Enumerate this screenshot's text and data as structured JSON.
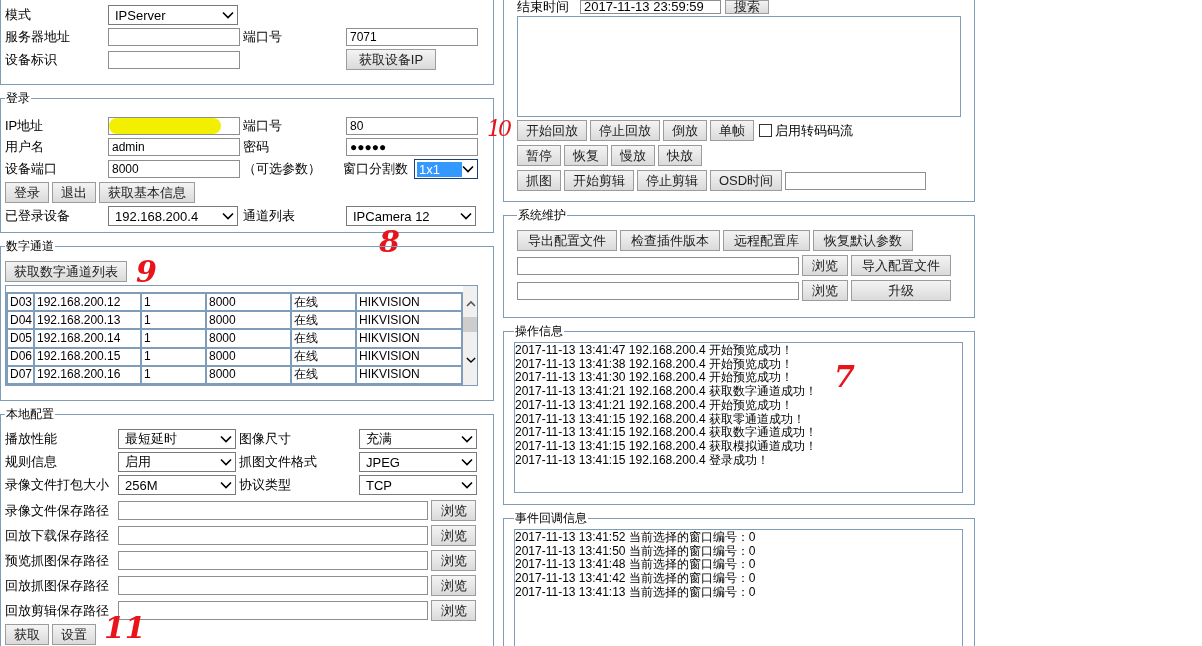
{
  "server": {
    "mode": {
      "label": "模式",
      "value": "IPServer"
    },
    "server_address": {
      "label": "服务器地址"
    },
    "port": {
      "label": "端口号",
      "value": "7071"
    },
    "device_id": {
      "label": "设备标识"
    },
    "button": "获取设备IP"
  },
  "login": {
    "title": "登录",
    "ip": {
      "label": "IP地址",
      "redacted": true
    },
    "port": {
      "label": "端口号",
      "value": "80"
    },
    "username": {
      "label": "用户名",
      "value": "admin"
    },
    "password": {
      "label": "密码",
      "value": "●●●●●"
    },
    "device_port": {
      "label": "设备端口",
      "value": "8000"
    },
    "optional_note": "（可选参数）",
    "window_split": {
      "label": "窗口分割数",
      "value": "1x1",
      "focused": true
    },
    "buttons": [
      "登录",
      "退出",
      "获取基本信息"
    ],
    "logged_device": {
      "label": "已登录设备",
      "value": "192.168.200.4"
    },
    "channel_list": {
      "label": "通道列表",
      "value": "IPCamera 12"
    },
    "annotation": "8"
  },
  "digital_channels": {
    "title": "数字通道",
    "button": "获取数字通道列表",
    "annotation": "9",
    "rows": [
      [
        "D03",
        "192.168.200.12",
        "1",
        "8000",
        "在线",
        "HIKVISION"
      ],
      [
        "D04",
        "192.168.200.13",
        "1",
        "8000",
        "在线",
        "HIKVISION"
      ],
      [
        "D05",
        "192.168.200.14",
        "1",
        "8000",
        "在线",
        "HIKVISION"
      ],
      [
        "D06",
        "192.168.200.15",
        "1",
        "8000",
        "在线",
        "HIKVISION"
      ],
      [
        "D07",
        "192.168.200.16",
        "1",
        "8000",
        "在线",
        "HIKVISION"
      ]
    ]
  },
  "local_config": {
    "title": "本地配置",
    "annotation": "11",
    "selects": [
      {
        "label": "播放性能",
        "value": "最短延时"
      },
      {
        "label": "图像尺寸",
        "value": "充满"
      },
      {
        "label": "规则信息",
        "value": "启用"
      },
      {
        "label": "抓图文件格式",
        "value": "JPEG"
      },
      {
        "label": "录像文件打包大小",
        "value": "256M"
      },
      {
        "label": "协议类型",
        "value": "TCP"
      }
    ],
    "paths": [
      {
        "label": "录像文件保存路径",
        "button": "浏览"
      },
      {
        "label": "回放下载保存路径",
        "button": "浏览"
      },
      {
        "label": "预览抓图保存路径",
        "button": "浏览"
      },
      {
        "label": "回放抓图保存路径",
        "button": "浏览"
      },
      {
        "label": "回放剪辑保存路径",
        "button": "浏览"
      }
    ],
    "buttons": [
      "获取",
      "设置"
    ]
  },
  "playback": {
    "end_time": {
      "label": "结束时间",
      "value": "2017-11-13 23:59:59"
    },
    "search_button": "搜索",
    "annotation": "10",
    "button_rows": [
      [
        "开始回放",
        "停止回放",
        "倒放",
        "单帧"
      ],
      [
        "暂停",
        "恢复",
        "慢放",
        "快放"
      ],
      [
        "抓图",
        "开始剪辑",
        "停止剪辑",
        "OSD时间"
      ]
    ],
    "transcode": {
      "label": "启用转码码流",
      "checked": false
    }
  },
  "maintenance": {
    "title": "系统维护",
    "buttons": [
      "导出配置文件",
      "检查插件版本",
      "远程配置库",
      "恢复默认参数"
    ],
    "rows": [
      {
        "browse": "浏览",
        "action": "导入配置文件"
      },
      {
        "browse": "浏览",
        "action": "升级"
      }
    ]
  },
  "operation_log": {
    "title": "操作信息",
    "annotation": "7",
    "lines": [
      "2017-11-13 13:41:47 192.168.200.4 开始预览成功！",
      "2017-11-13 13:41:38 192.168.200.4 开始预览成功！",
      "2017-11-13 13:41:30 192.168.200.4 开始预览成功！",
      "2017-11-13 13:41:21 192.168.200.4 获取数字通道成功！",
      "2017-11-13 13:41:21 192.168.200.4 开始预览成功！",
      "2017-11-13 13:41:15 192.168.200.4 获取零通道成功！",
      "2017-11-13 13:41:15 192.168.200.4 获取数字通道成功！",
      "2017-11-13 13:41:15 192.168.200.4 获取模拟通道成功！",
      "2017-11-13 13:41:15 192.168.200.4 登录成功！"
    ]
  },
  "event_log": {
    "title": "事件回调信息",
    "lines": [
      "2017-11-13 13:41:52 当前选择的窗口编号：0",
      "2017-11-13 13:41:50 当前选择的窗口编号：0",
      "2017-11-13 13:41:48 当前选择的窗口编号：0",
      "2017-11-13 13:41:42 当前选择的窗口编号：0",
      "2017-11-13 13:41:13 当前选择的窗口编号：0"
    ]
  }
}
